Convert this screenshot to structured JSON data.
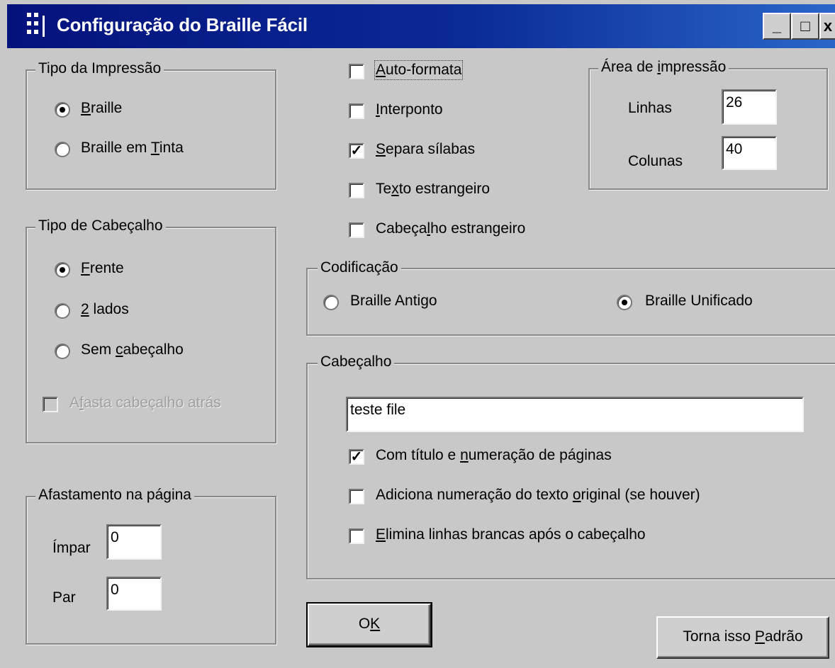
{
  "window": {
    "title": "Configuração do Braille Fácil",
    "minimize": "_",
    "maximize": "□",
    "close": "x",
    "icon": "braille-dots-icon"
  },
  "tipo_impressao": {
    "label": "Tipo da Impressão",
    "options": [
      {
        "before": "",
        "key": "B",
        "after": "raille",
        "selected": true
      },
      {
        "before": "Braille em ",
        "key": "T",
        "after": "inta",
        "selected": false
      }
    ]
  },
  "tipo_cabecalho": {
    "label": "Tipo de Cabeçalho",
    "options": [
      {
        "before": "",
        "key": "F",
        "after": "rente",
        "selected": true
      },
      {
        "before": "",
        "key": "2",
        "after": " lados",
        "selected": false
      },
      {
        "before": "Sem ",
        "key": "c",
        "after": "abeçalho",
        "selected": false
      }
    ],
    "afasta": {
      "before": "A",
      "key": "f",
      "after": "asta cabeçalho atrás",
      "checked": false,
      "disabled": true
    }
  },
  "afastamento": {
    "label": "Afastamento na  página",
    "impar_label": "Ímpar",
    "impar_value": "0",
    "par_label": "Par",
    "par_value": "0"
  },
  "opcoes": [
    {
      "before": "",
      "key": "A",
      "after": "uto-formata",
      "checked": false
    },
    {
      "before": "",
      "key": "I",
      "after": "nterponto",
      "checked": false
    },
    {
      "before": "",
      "key": "S",
      "after": "epara sílabas",
      "checked": true
    },
    {
      "before": "Te",
      "key": "x",
      "after": "to estrangeiro",
      "checked": false
    },
    {
      "before": "Cabeça",
      "key": "l",
      "after": "ho estrangeiro",
      "checked": false
    }
  ],
  "area_impressao": {
    "label_before": "Área de ",
    "label_key": "i",
    "label_after": "mpressão",
    "linhas_label": "Linhas",
    "linhas_value": "26",
    "colunas_label": "Colunas",
    "colunas_value": "40"
  },
  "codificacao": {
    "label": "Codificação",
    "antigo": {
      "label": "Braille Antigo",
      "selected": false
    },
    "unificado": {
      "label": "Braille Unificado",
      "selected": true
    }
  },
  "cabecalho": {
    "label": "Cabeçalho",
    "text_value": "teste  file",
    "com_titulo": {
      "before": "Com título e ",
      "key": "n",
      "after": "umeração de páginas",
      "checked": true
    },
    "adiciona": {
      "before": "Adiciona numeração do texto ",
      "key": "o",
      "after": "riginal (se houver)",
      "checked": false
    },
    "elimina": {
      "before": "",
      "key": "E",
      "after": "limina linhas brancas após o cabeçalho",
      "checked": false
    }
  },
  "buttons": {
    "ok_before": "O",
    "ok_key": "K",
    "padrao_before": "Torna isso ",
    "padrao_key": "P",
    "padrao_after": "adrão"
  },
  "colors": {
    "titlebar_start": "#04127c",
    "titlebar_end": "#2a66c8",
    "dialog_bg": "#c8c8c8"
  }
}
